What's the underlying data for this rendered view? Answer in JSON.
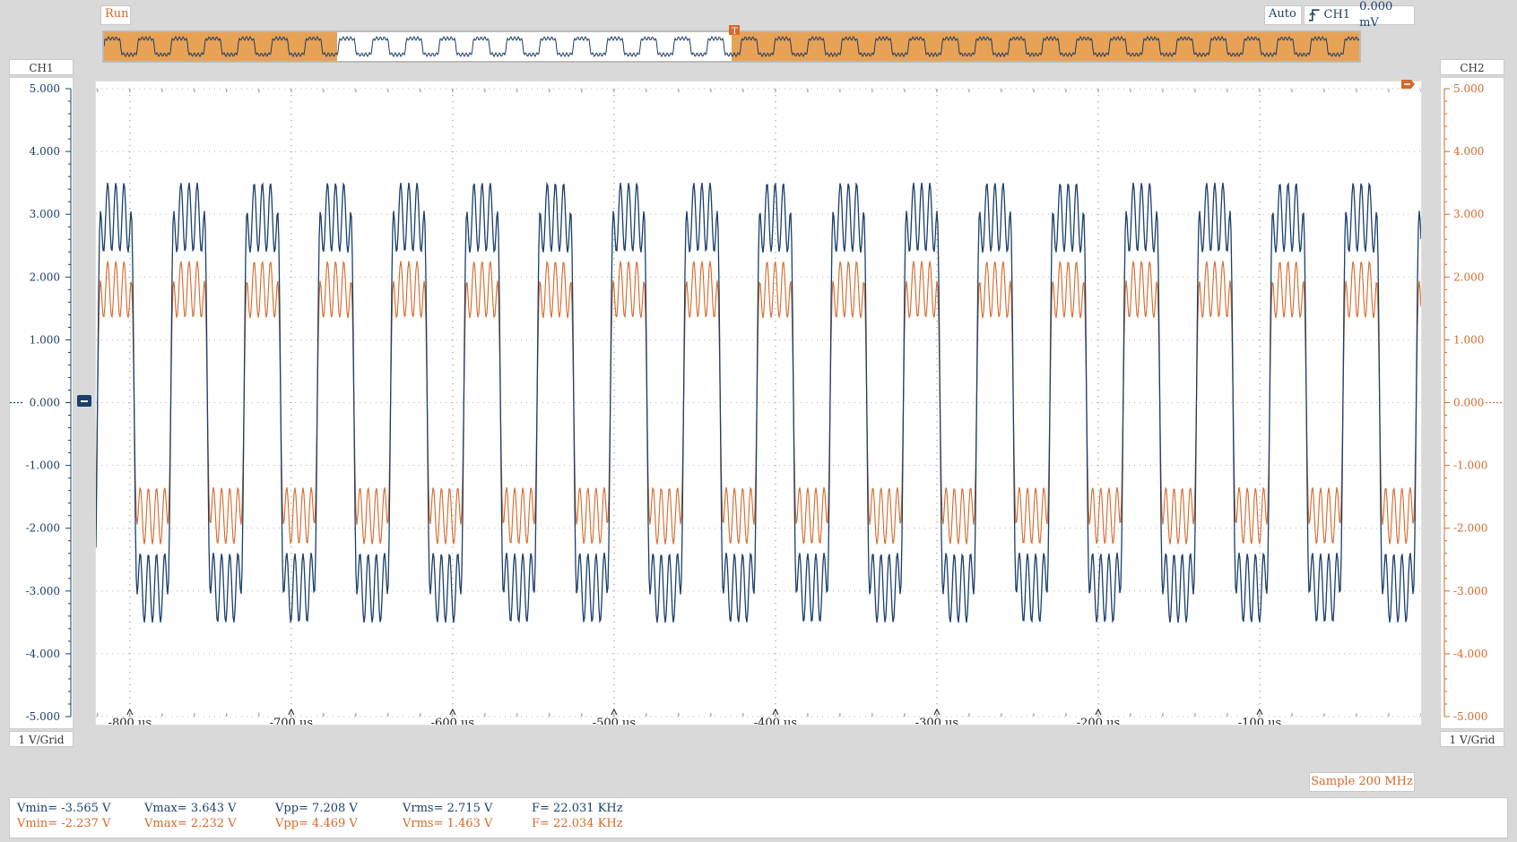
{
  "toolbar": {
    "run_label": "Run",
    "trigger_mode": "Auto",
    "trigger_channel": "CH1",
    "trigger_level": "0.000 mV",
    "edge_icon": "rising-edge-icon"
  },
  "channels": {
    "ch1": {
      "label": "CH1",
      "scale": "1 V/Grid",
      "color": "#1a3f6a"
    },
    "ch2": {
      "label": "CH2",
      "scale": "1 V/Grid",
      "color": "#d2692a"
    }
  },
  "y_ticks": [
    "5.000",
    "4.000",
    "3.000",
    "2.000",
    "1.000",
    "0.000",
    "-1.000",
    "-2.000",
    "-3.000",
    "-4.000",
    "-5.000"
  ],
  "x_ticks": [
    "-800 us",
    "-700 us",
    "-600 us",
    "-500 us",
    "-400 us",
    "-300 us",
    "-200 us",
    "-100 us"
  ],
  "sample_rate": "Sample 200 MHz",
  "measurements": {
    "ch1": {
      "vmin": "Vmin= -3.565 V",
      "vmax": "Vmax= 3.643 V",
      "vpp": "Vpp= 7.208 V",
      "vrms": "Vrms= 2.715 V",
      "freq": "F= 22.031 KHz"
    },
    "ch2": {
      "vmin": "Vmin= -2.237 V",
      "vmax": "Vmax= 2.232 V",
      "vpp": "Vpp= 4.469 V",
      "vrms": "Vrms= 1.463 V",
      "freq": "F= 22.034 KHz"
    }
  },
  "chart_data": {
    "type": "line",
    "x_unit": "us",
    "y_unit": "V",
    "xlim": [
      -821,
      0
    ],
    "ylim": [
      -5,
      5
    ],
    "grid": true,
    "series": [
      {
        "name": "CH1",
        "color": "#1a3f6a",
        "amplitude": 3.6,
        "freq_khz": 22.031
      },
      {
        "name": "CH2",
        "color": "#d2692a",
        "amplitude": 2.2,
        "freq_khz": 22.034
      }
    ]
  }
}
